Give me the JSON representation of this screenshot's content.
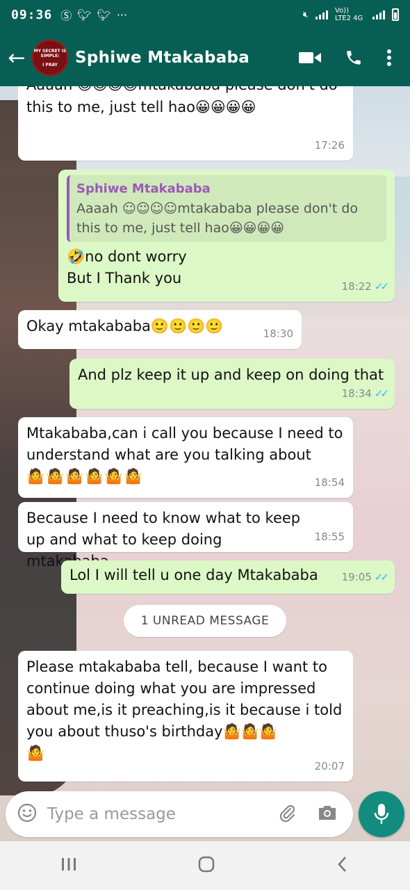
{
  "status_bar": {
    "time": "09:36",
    "left_icons": [
      "swift-key-icon",
      "twitter-icon",
      "twitter-icon",
      "more-dots"
    ],
    "network": "Vo)) LTE2 4G"
  },
  "header": {
    "contact_name": "Sphiwe Mtakababa",
    "avatar_text_top": "MY SECRET IS SIMPLE:",
    "avatar_text_bottom": "I PRAY"
  },
  "colors": {
    "header": "#075e54",
    "incoming": "#ffffff",
    "outgoing": "#dcf8c6",
    "ticks": "#34b7f1",
    "mic": "#128c7e"
  },
  "messages": [
    {
      "dir": "in",
      "text": "Aaaah 😊😊😊😊mtakababa please don't do this to me, just tell hao😀😀😀😀",
      "time": "17:26"
    },
    {
      "dir": "out",
      "quote_name": "Sphiwe Mtakababa",
      "quote_text": "Aaaah ☺☺☺☺mtakababa please don't do this to me, just tell hao😀😀😀😀",
      "line1": "🤣no dont worry",
      "line2": "But I Thank you",
      "time": "18:22",
      "ticks": "✓✓"
    },
    {
      "dir": "in",
      "text": "Okay mtakababa🙂🙂🙂🙂",
      "time": "18:30"
    },
    {
      "dir": "out",
      "text": "And plz keep it up and keep on doing that",
      "time": "18:34",
      "ticks": "✓✓"
    },
    {
      "dir": "in",
      "text": "Mtakababa,can i call you because I need to understand what are you talking about",
      "emoji_line": "🤷🤷🤷🤷🤷🤷",
      "time": "18:54"
    },
    {
      "dir": "in",
      "text": "Because I need to know what to keep up and what to keep doing mtakababa",
      "time": "18:55"
    },
    {
      "dir": "out",
      "text": "Lol I will  tell u one day Mtakababa",
      "time": "19:05",
      "ticks": "✓✓"
    },
    {
      "dir": "in",
      "text": "Please mtakababa tell, because I want to continue doing what you are impressed about me,is it preaching,is it because i told you about thuso's birthday🤷🤷🤷",
      "emoji_line": "🤷",
      "time": "20:07"
    }
  ],
  "unread_banner": "1 UNREAD MESSAGE",
  "input": {
    "placeholder": "Type a message"
  },
  "nav": [
    "recent-apps",
    "home",
    "back"
  ]
}
